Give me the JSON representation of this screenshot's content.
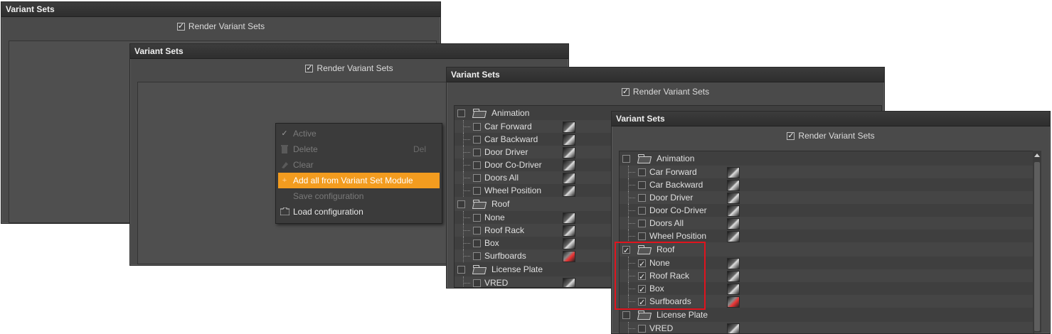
{
  "panel_title": "Variant Sets",
  "render_label": "Render Variant Sets",
  "context_menu": {
    "items": [
      {
        "label": "Active",
        "icon": "check-icon",
        "shortcut": "",
        "enabled": false
      },
      {
        "label": "Delete",
        "icon": "trash-icon",
        "shortcut": "Del",
        "enabled": false
      },
      {
        "label": "Clear",
        "icon": "eraser-icon",
        "shortcut": "",
        "enabled": false
      },
      {
        "label": "Add all from Variant Set Module",
        "icon": "plus-icon",
        "shortcut": "",
        "enabled": true,
        "highlighted": true
      },
      {
        "label": "Save configuration",
        "icon": "",
        "shortcut": "",
        "enabled": false
      },
      {
        "label": "Load configuration",
        "icon": "folder-icon",
        "shortcut": "",
        "enabled": true
      }
    ]
  },
  "tree": {
    "groups": [
      {
        "name": "Animation",
        "children": [
          "Car Forward",
          "Car Backward",
          "Door Driver",
          "Door Co-Driver",
          "Doors All",
          "Wheel Position"
        ]
      },
      {
        "name": "Roof",
        "children": [
          "None",
          "Roof Rack",
          "Box",
          "Surfboards"
        ]
      },
      {
        "name": "License Plate",
        "children": [
          "VRED"
        ]
      }
    ]
  },
  "colors": {
    "highlight": "#f39c1f",
    "annotation": "#e0141e"
  }
}
